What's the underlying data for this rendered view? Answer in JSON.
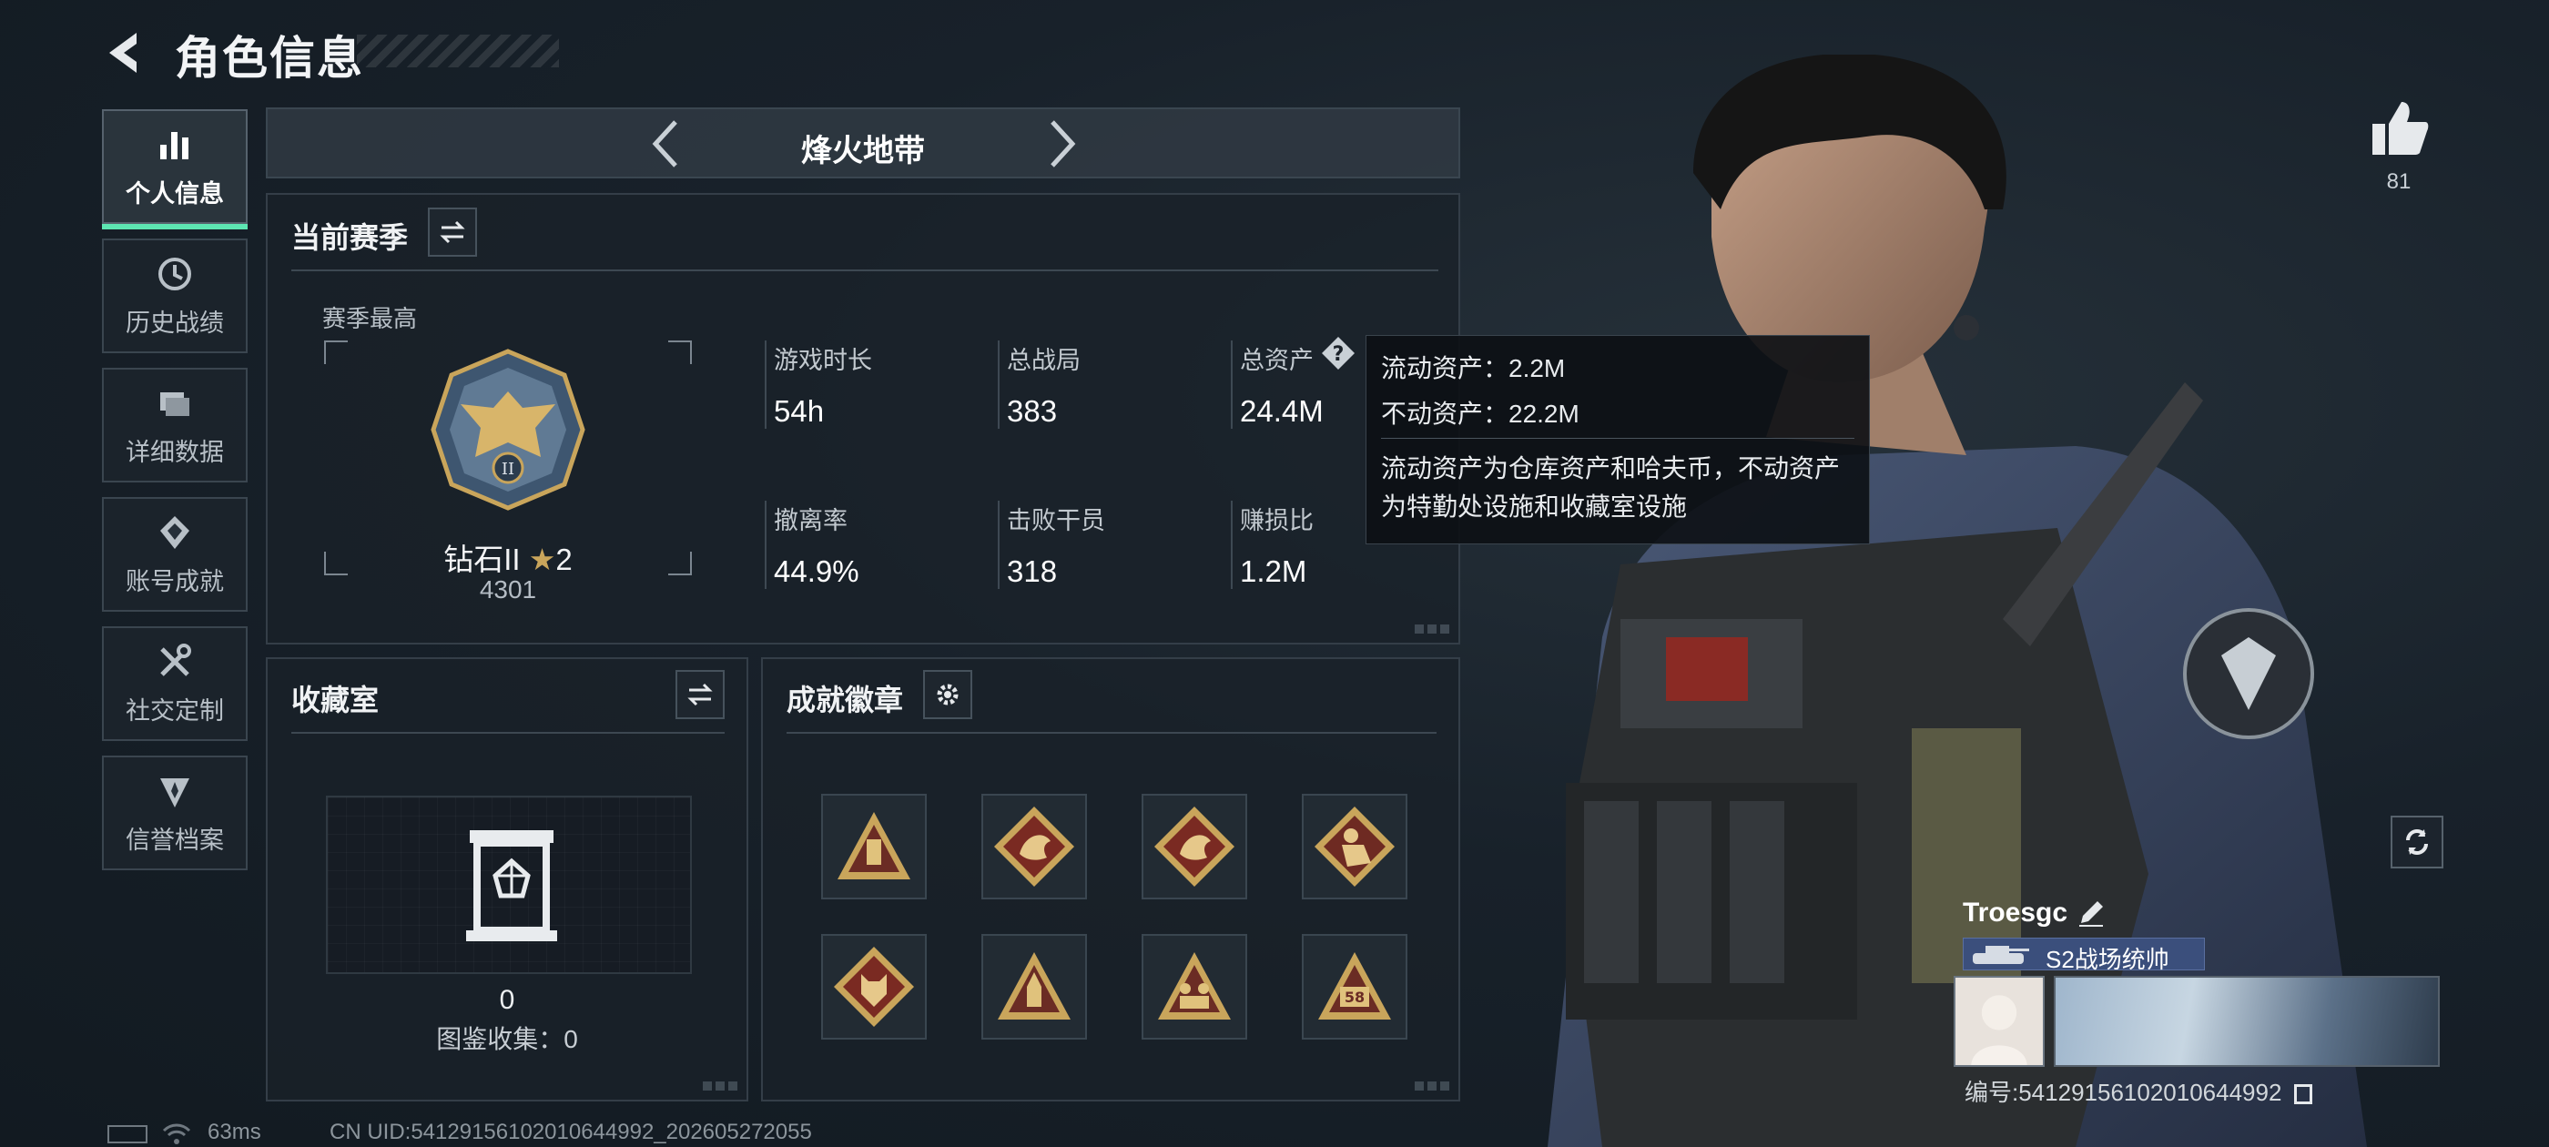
{
  "header": {
    "title": "角色信息"
  },
  "nav": {
    "items": [
      {
        "label": "个人信息",
        "icon": "bar-chart-icon",
        "active": true
      },
      {
        "label": "历史战绩",
        "icon": "history-clock-icon"
      },
      {
        "label": "详细数据",
        "icon": "folder-icon"
      },
      {
        "label": "账号成就",
        "icon": "achievement-icon"
      },
      {
        "label": "社交定制",
        "icon": "tools-icon"
      },
      {
        "label": "信誉档案",
        "icon": "credit-shield-icon"
      }
    ]
  },
  "map_selector": {
    "name": "烽火地带"
  },
  "season": {
    "title": "当前赛季",
    "best_label": "赛季最高",
    "rank_name": "钻石II",
    "rank_stars": "2",
    "rank_score": "4301",
    "stats": [
      {
        "label": "游戏时长",
        "value": "54h"
      },
      {
        "label": "总战局",
        "value": "383"
      },
      {
        "label": "总资产",
        "value": "24.4M"
      },
      {
        "label": "撤离率",
        "value": "44.9%"
      },
      {
        "label": "击败干员",
        "value": "318"
      },
      {
        "label": "赚损比",
        "value": "1.2M"
      }
    ]
  },
  "tooltip": {
    "liquid": "流动资产：2.2M",
    "fixed": "不动资产：22.2M",
    "desc_line1": "流动资产为仓库资产和哈夫币，不动资产",
    "desc_line2": "为特勤处设施和收藏室设施"
  },
  "collection": {
    "title": "收藏室",
    "count": "0",
    "label": "图鉴收集：0"
  },
  "achievements": {
    "title": "成就徽章",
    "badges": [
      {
        "icon": "ammo-triangle-icon"
      },
      {
        "icon": "dragon-diamond-icon"
      },
      {
        "icon": "dragon-diamond-icon"
      },
      {
        "icon": "soldier-diamond-icon"
      },
      {
        "icon": "wolf-diamond-icon"
      },
      {
        "icon": "rocket-triangle-icon"
      },
      {
        "icon": "squad-triangle-icon"
      },
      {
        "icon": "number-triangle-icon",
        "text": "58"
      }
    ]
  },
  "like": {
    "count": "81"
  },
  "player": {
    "name": "Troesgc",
    "title": "S2战场统帅",
    "id": "编号:54129156102010644992"
  },
  "footer": {
    "ping": "63ms",
    "uid": "CN UID:54129156102010644992_202605272055"
  },
  "colors": {
    "accent": "#5de6b2",
    "title_badge": "#3b4f7c",
    "gold": "#c9a55b"
  }
}
